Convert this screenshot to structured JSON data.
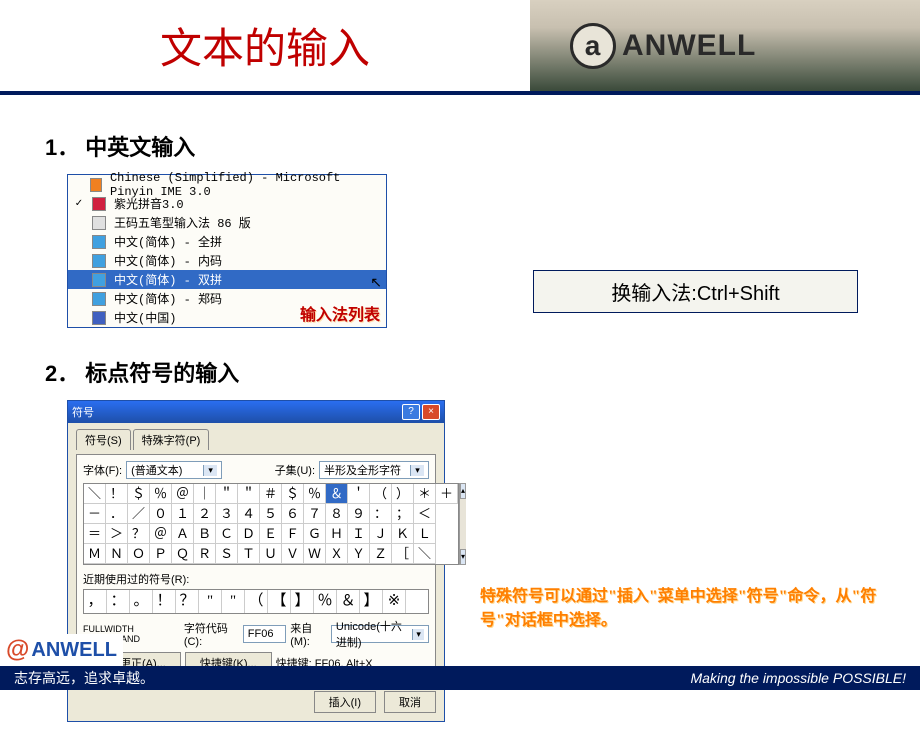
{
  "header": {
    "title": "文本的输入",
    "brand": "ANWELL"
  },
  "section1": {
    "num": "1．",
    "title": "中英文输入",
    "ime_items": [
      {
        "check": "",
        "icon_bg": "#f08020",
        "label": "Chinese (Simplified) - Microsoft Pinyin IME 3.0"
      },
      {
        "check": "✓",
        "icon_bg": "#d02040",
        "label": "紫光拼音3.0"
      },
      {
        "check": "",
        "icon_bg": "#e0e0e0",
        "label": "王码五笔型输入法 86 版"
      },
      {
        "check": "",
        "icon_bg": "#40a0e0",
        "label": "中文(简体) - 全拼"
      },
      {
        "check": "",
        "icon_bg": "#40a0e0",
        "label": "中文(简体) - 内码"
      },
      {
        "check": "",
        "icon_bg": "#40a0e0",
        "label": "中文(简体) - 双拼"
      },
      {
        "check": "",
        "icon_bg": "#40a0e0",
        "label": "中文(简体) - 郑码"
      },
      {
        "check": "",
        "icon_bg": "#4060c0",
        "label": "中文(中国)"
      }
    ],
    "ime_selected_index": 5,
    "ime_corner_label": "输入法列表",
    "shortcut_text": "换输入法:Ctrl+Shift"
  },
  "section2": {
    "num": "2．",
    "title": "标点符号的输入",
    "dlg_title": "符号",
    "tabs": [
      "符号(S)",
      "特殊字符(P)"
    ],
    "font_label": "字体(F):",
    "font_value": "(普通文本)",
    "subset_label": "子集(U):",
    "subset_value": "半形及全形字符",
    "grid": [
      [
        "＼",
        "！",
        "＄",
        "％",
        "＠",
        "｜",
        "＂",
        "＂",
        "＃",
        "＄",
        "％",
        "＆",
        "＇",
        "（",
        "）",
        "＊",
        "＋"
      ],
      [
        "－",
        "．",
        "／",
        "０",
        "１",
        "２",
        "３",
        "４",
        "５",
        "６",
        "７",
        "８",
        "９",
        "：",
        "；",
        "＜"
      ],
      [
        "＝",
        "＞",
        "？",
        "＠",
        "Ａ",
        "Ｂ",
        "Ｃ",
        "Ｄ",
        "Ｅ",
        "Ｆ",
        "Ｇ",
        "Ｈ",
        "Ｉ",
        "Ｊ",
        "Ｋ",
        "Ｌ"
      ],
      [
        "Ｍ",
        "Ｎ",
        "Ｏ",
        "Ｐ",
        "Ｑ",
        "Ｒ",
        "Ｓ",
        "Ｔ",
        "Ｕ",
        "Ｖ",
        "Ｗ",
        "Ｘ",
        "Ｙ",
        "Ｚ",
        "［",
        "＼"
      ]
    ],
    "grid_selected": [
      0,
      11
    ],
    "recent_label": "近期使用过的符号(R):",
    "recent": [
      "，",
      "：",
      "。",
      "！",
      "？",
      "\"",
      "\"",
      "（",
      "【",
      "】",
      "％",
      "＆",
      "】",
      "※"
    ],
    "char_name": "FULLWIDTH AMPERSAND",
    "code_label": "字符代码(C):",
    "code_value": "FF06",
    "from_label": "来自(M):",
    "from_value": "Unicode(十六进制)",
    "autocorrect_btn": "自动更正(A)...",
    "shortcut_btn": "快捷键(K)...",
    "shortcut_text_label": "快捷键: FF06, Alt+X",
    "insert_btn": "插入(I)",
    "cancel_btn": "取消"
  },
  "note": "特殊符号可以通过\"插入\"菜单中选择\"符号\"命令，从\"符号\"对话框中选择。",
  "footer": {
    "brand": "ANWELL",
    "left": "志存高远，追求卓越。",
    "right": "Making the impossible POSSIBLE!"
  }
}
